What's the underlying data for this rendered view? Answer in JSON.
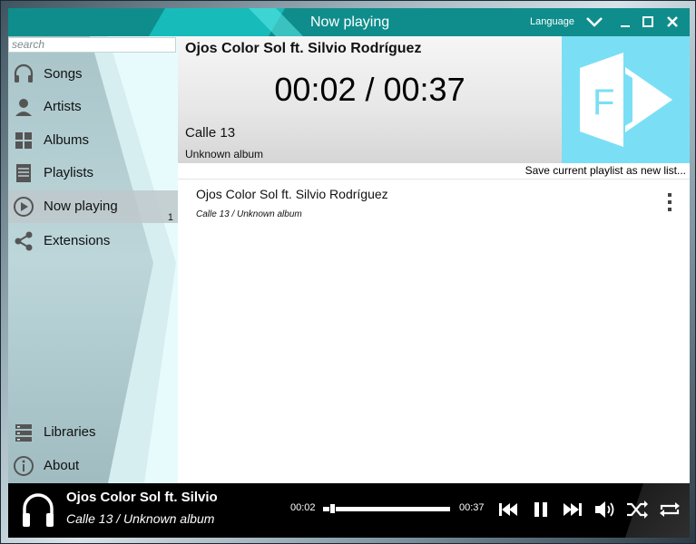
{
  "window": {
    "title": "Now playing",
    "language_label": "Language"
  },
  "sidebar": {
    "search_placeholder": "search",
    "items": [
      {
        "label": "Songs",
        "icon": "headphones-icon"
      },
      {
        "label": "Artists",
        "icon": "person-icon"
      },
      {
        "label": "Albums",
        "icon": "grid-icon"
      },
      {
        "label": "Playlists",
        "icon": "list-icon"
      },
      {
        "label": "Now playing",
        "icon": "play-circle-icon",
        "count": "1",
        "active": true
      },
      {
        "label": "Extensions",
        "icon": "share-icon"
      }
    ],
    "bottom_items": [
      {
        "label": "Libraries",
        "icon": "server-icon"
      },
      {
        "label": "About",
        "icon": "info-icon"
      }
    ]
  },
  "now_playing": {
    "title": "Ojos Color Sol ft. Silvio Rodríguez",
    "time_display": "00:02 / 00:37",
    "artist": "Calle 13",
    "album": "Unknown album",
    "save_playlist_label": "Save current playlist as new list..."
  },
  "queue": [
    {
      "title": "Ojos Color Sol ft. Silvio Rodríguez",
      "subtitle": "Calle 13 / Unknown album"
    }
  ],
  "player": {
    "title": "Ojos Color Sol ft. Silvio",
    "subtitle": "Calle 13 / Unknown album",
    "current_time": "00:02",
    "duration": "00:37",
    "progress": 0.054
  },
  "colors": {
    "accent": "#0f8d8c",
    "logo_bg": "#7adff5",
    "player_bg": "#000000"
  }
}
